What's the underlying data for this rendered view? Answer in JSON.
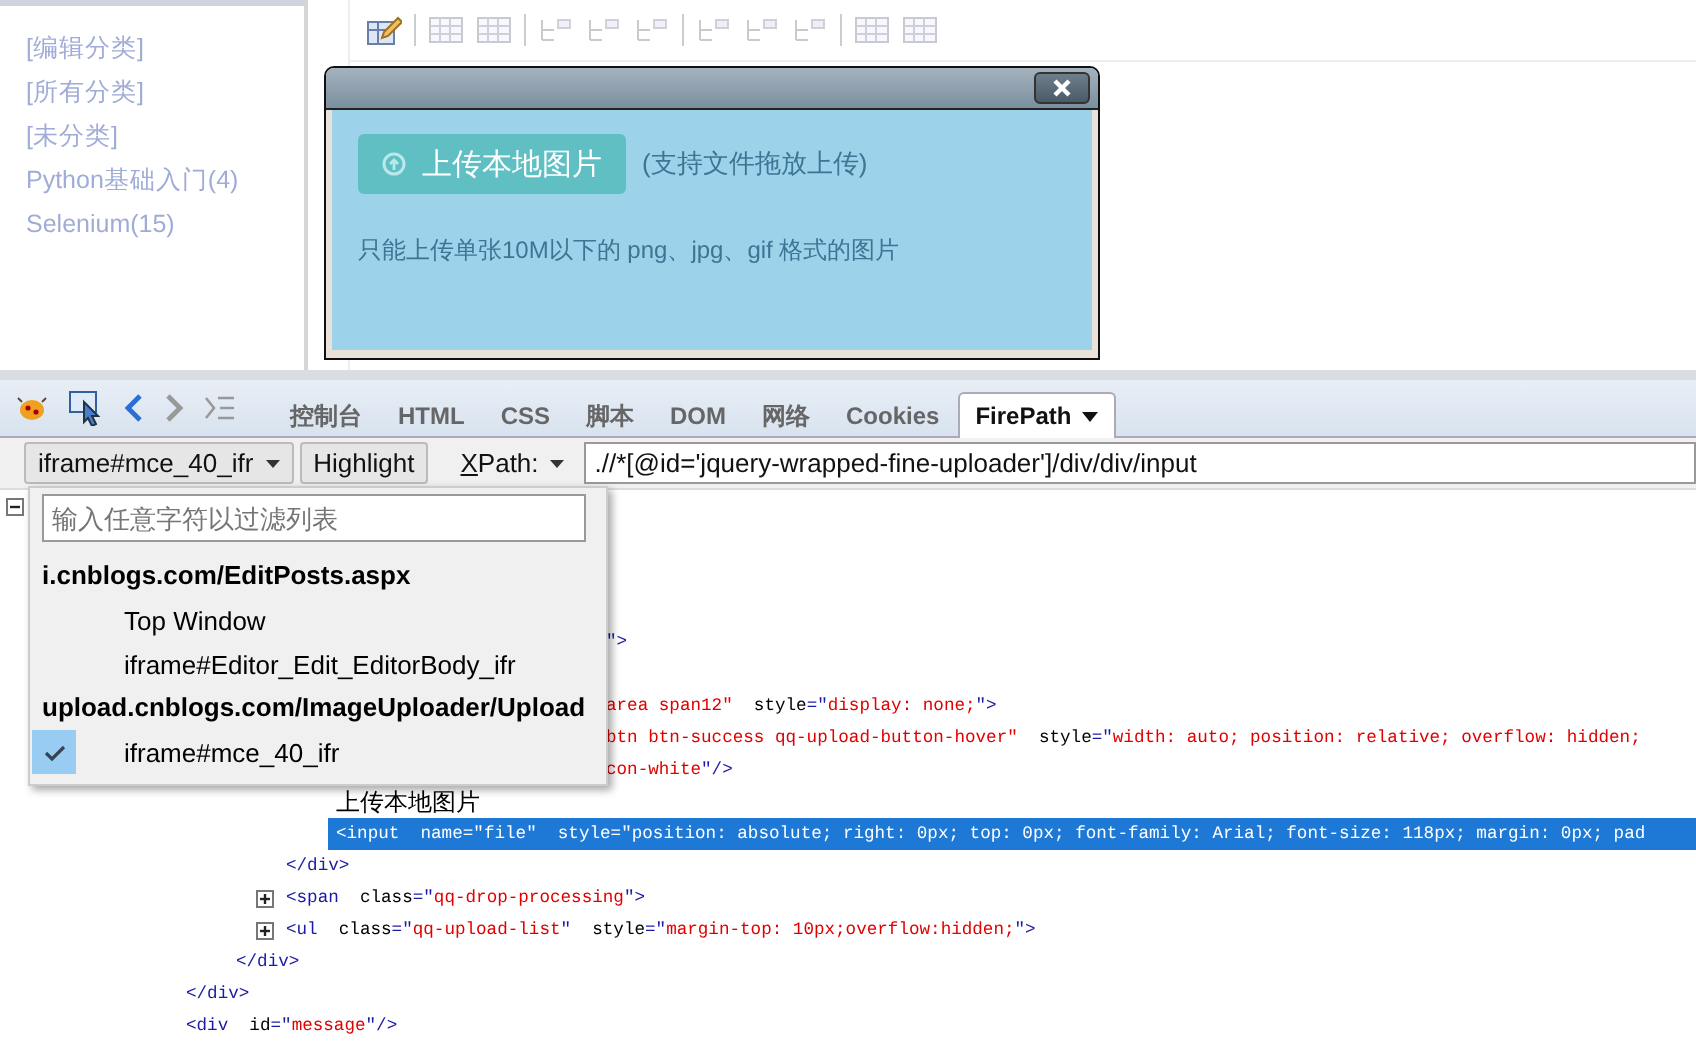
{
  "sidebar": {
    "categories": [
      {
        "label": "[编辑分类]"
      },
      {
        "label": "[所有分类]"
      },
      {
        "label": "[未分类]"
      },
      {
        "label": "Python基础入门(4)"
      },
      {
        "label": "Selenium(15)"
      }
    ]
  },
  "dialog": {
    "upload_button": "上传本地图片",
    "hint": "(支持文件拖放上传)",
    "note": "只能上传单张10M以下的 png、jpg、gif 格式的图片"
  },
  "devtools": {
    "tabs": [
      {
        "label": "控制台",
        "selected": false
      },
      {
        "label": "HTML",
        "selected": false
      },
      {
        "label": "CSS",
        "selected": false
      },
      {
        "label": "脚本",
        "selected": false
      },
      {
        "label": "DOM",
        "selected": false
      },
      {
        "label": "网络",
        "selected": false
      },
      {
        "label": "Cookies",
        "selected": false
      },
      {
        "label": "FirePath",
        "selected": true
      }
    ],
    "frame_select": "iframe#mce_40_ifr",
    "highlight_button": "Highlight",
    "mode_select": "XPath:",
    "xpath_value": ".//*[@id='jquery-wrapped-fine-uploader']/div/div/input",
    "frame_menu": {
      "filter_placeholder": "输入任意字符以过滤列表",
      "groups": [
        {
          "title": "i.cnblogs.com/EditPosts.aspx",
          "items": [
            {
              "label": "Top Window",
              "selected": false
            },
            {
              "label": "iframe#Editor_Edit_EditorBody_ifr",
              "selected": false
            }
          ]
        },
        {
          "title": "upload.cnblogs.com/ImageUploader/Upload",
          "items": [
            {
              "label": "iframe#mce_40_ifr",
              "selected": true
            }
          ]
        }
      ]
    }
  },
  "listing": {
    "expanded": true,
    "partial_lines": [
      {
        "kind": "covered"
      },
      {
        "kind": "covered"
      },
      {
        "kind": "covered"
      },
      {
        "kind": "covered"
      },
      {
        "kind": "code",
        "parts": [
          {
            "kind": "punct",
            "text": "\">"
          }
        ]
      },
      {
        "kind": "covered"
      },
      {
        "kind": "code",
        "parts": [
          {
            "kind": "value",
            "text": "area span12\""
          },
          {
            "kind": "attr",
            "text": "  style"
          },
          {
            "kind": "punct",
            "text": "=\""
          },
          {
            "kind": "value",
            "text": "display: none;"
          },
          {
            "kind": "punct",
            "text": "\">"
          }
        ]
      },
      {
        "kind": "code",
        "parts": [
          {
            "kind": "value",
            "text": "btn btn-success qq-upload-button-hover\""
          },
          {
            "kind": "attr",
            "text": "  style"
          },
          {
            "kind": "punct",
            "text": "=\""
          },
          {
            "kind": "value",
            "text": "width: auto; position: relative; overflow: hidden;"
          }
        ]
      },
      {
        "kind": "code",
        "parts": [
          {
            "kind": "value",
            "text": "con-white"
          },
          {
            "kind": "punct",
            "text": "\"/>"
          }
        ]
      }
    ],
    "tree": [
      {
        "children": [
          {
            "children": [
              {
                "children": [
                  {
                    "selected": false,
                    "parts": [
                      {
                        "kind": "text",
                        "text": "上传本地图片"
                      }
                    ]
                  },
                  {
                    "selected": true,
                    "parts": [
                      {
                        "kind": "tag",
                        "text": "<input"
                      },
                      {
                        "kind": "attr",
                        "text": "  name"
                      },
                      {
                        "kind": "punct",
                        "text": "=\""
                      },
                      {
                        "kind": "value",
                        "text": "file"
                      },
                      {
                        "kind": "punct",
                        "text": "\""
                      },
                      {
                        "kind": "attr",
                        "text": "  style"
                      },
                      {
                        "kind": "punct",
                        "text": "=\""
                      },
                      {
                        "kind": "value",
                        "text": "position: absolute; right: 0px; top: 0px; font-family: Arial; font-size: 118px; margin: 0px; pad"
                      }
                    ]
                  }
                ]
              },
              {
                "selected": false,
                "parts": [
                  {
                    "kind": "tag",
                    "text": "</div>"
                  }
                ]
              },
              {
                "selected": false,
                "expanded": false,
                "parts": [
                  {
                    "kind": "tag",
                    "text": "<span"
                  },
                  {
                    "kind": "attr",
                    "text": "  class"
                  },
                  {
                    "kind": "punct",
                    "text": "=\""
                  },
                  {
                    "kind": "value",
                    "text": "qq-drop-processing"
                  },
                  {
                    "kind": "punct",
                    "text": "\">"
                  }
                ]
              },
              {
                "selected": false,
                "expanded": false,
                "parts": [
                  {
                    "kind": "tag",
                    "text": "<ul"
                  },
                  {
                    "kind": "attr",
                    "text": "  class"
                  },
                  {
                    "kind": "punct",
                    "text": "=\""
                  },
                  {
                    "kind": "value",
                    "text": "qq-upload-list"
                  },
                  {
                    "kind": "punct",
                    "text": "\""
                  },
                  {
                    "kind": "attr",
                    "text": "  style"
                  },
                  {
                    "kind": "punct",
                    "text": "=\""
                  },
                  {
                    "kind": "value",
                    "text": "margin-top: 10px;overflow:hidden;"
                  },
                  {
                    "kind": "punct",
                    "text": "\">"
                  }
                ]
              }
            ]
          },
          {
            "selected": false,
            "parts": [
              {
                "kind": "tag",
                "text": "</div>"
              }
            ]
          }
        ]
      },
      {
        "selected": false,
        "parts": [
          {
            "kind": "tag",
            "text": "</div>"
          }
        ]
      },
      {
        "selected": false,
        "parts": [
          {
            "kind": "tag",
            "text": "<div"
          },
          {
            "kind": "attr",
            "text": "  id"
          },
          {
            "kind": "punct",
            "text": "=\""
          },
          {
            "kind": "value",
            "text": "message"
          },
          {
            "kind": "punct",
            "text": "\"/>"
          }
        ]
      }
    ]
  }
}
